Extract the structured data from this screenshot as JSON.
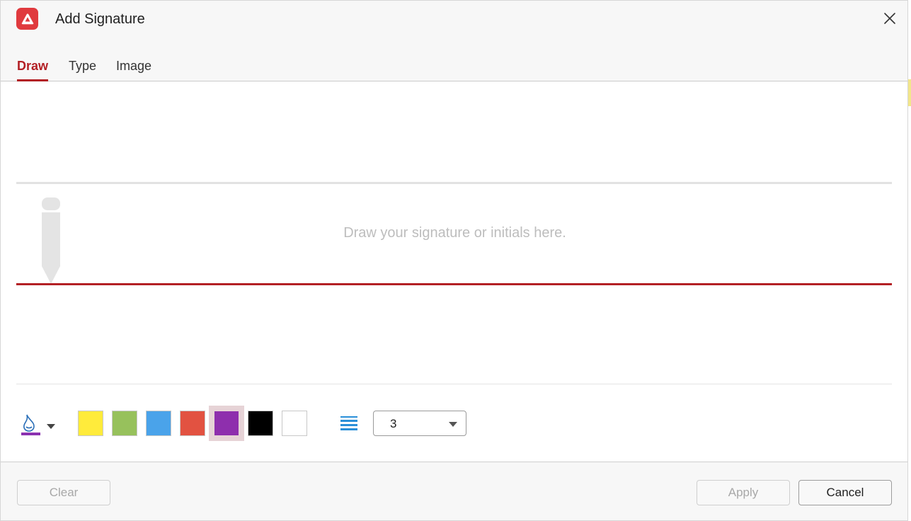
{
  "dialog": {
    "title": "Add Signature",
    "app_icon": "app-logo-icon",
    "close_icon": "close-icon"
  },
  "tabs": [
    {
      "label": "Draw",
      "active": true
    },
    {
      "label": "Type",
      "active": false
    },
    {
      "label": "Image",
      "active": false
    }
  ],
  "canvas": {
    "placeholder": "Draw your signature or initials here.",
    "baseline_color": "#b32025",
    "pen_icon": "pen-icon"
  },
  "toolbar": {
    "ink_icon": "ink-bottle-icon",
    "ink_color": "#8b32b0",
    "swatches": [
      {
        "color": "#ffeb3b",
        "selected": false
      },
      {
        "color": "#97c15c",
        "selected": false
      },
      {
        "color": "#4aa3ea",
        "selected": false
      },
      {
        "color": "#e25241",
        "selected": false
      },
      {
        "color": "#8e2fad",
        "selected": true
      },
      {
        "color": "#000000",
        "selected": false
      },
      {
        "color": "#ffffff",
        "selected": false
      }
    ],
    "line_width_icon": "line-width-icon",
    "line_width_value": "3"
  },
  "footer": {
    "clear_label": "Clear",
    "apply_label": "Apply",
    "cancel_label": "Cancel"
  },
  "colors": {
    "accent": "#b32025",
    "app_icon_bg": "#e03a3e"
  }
}
